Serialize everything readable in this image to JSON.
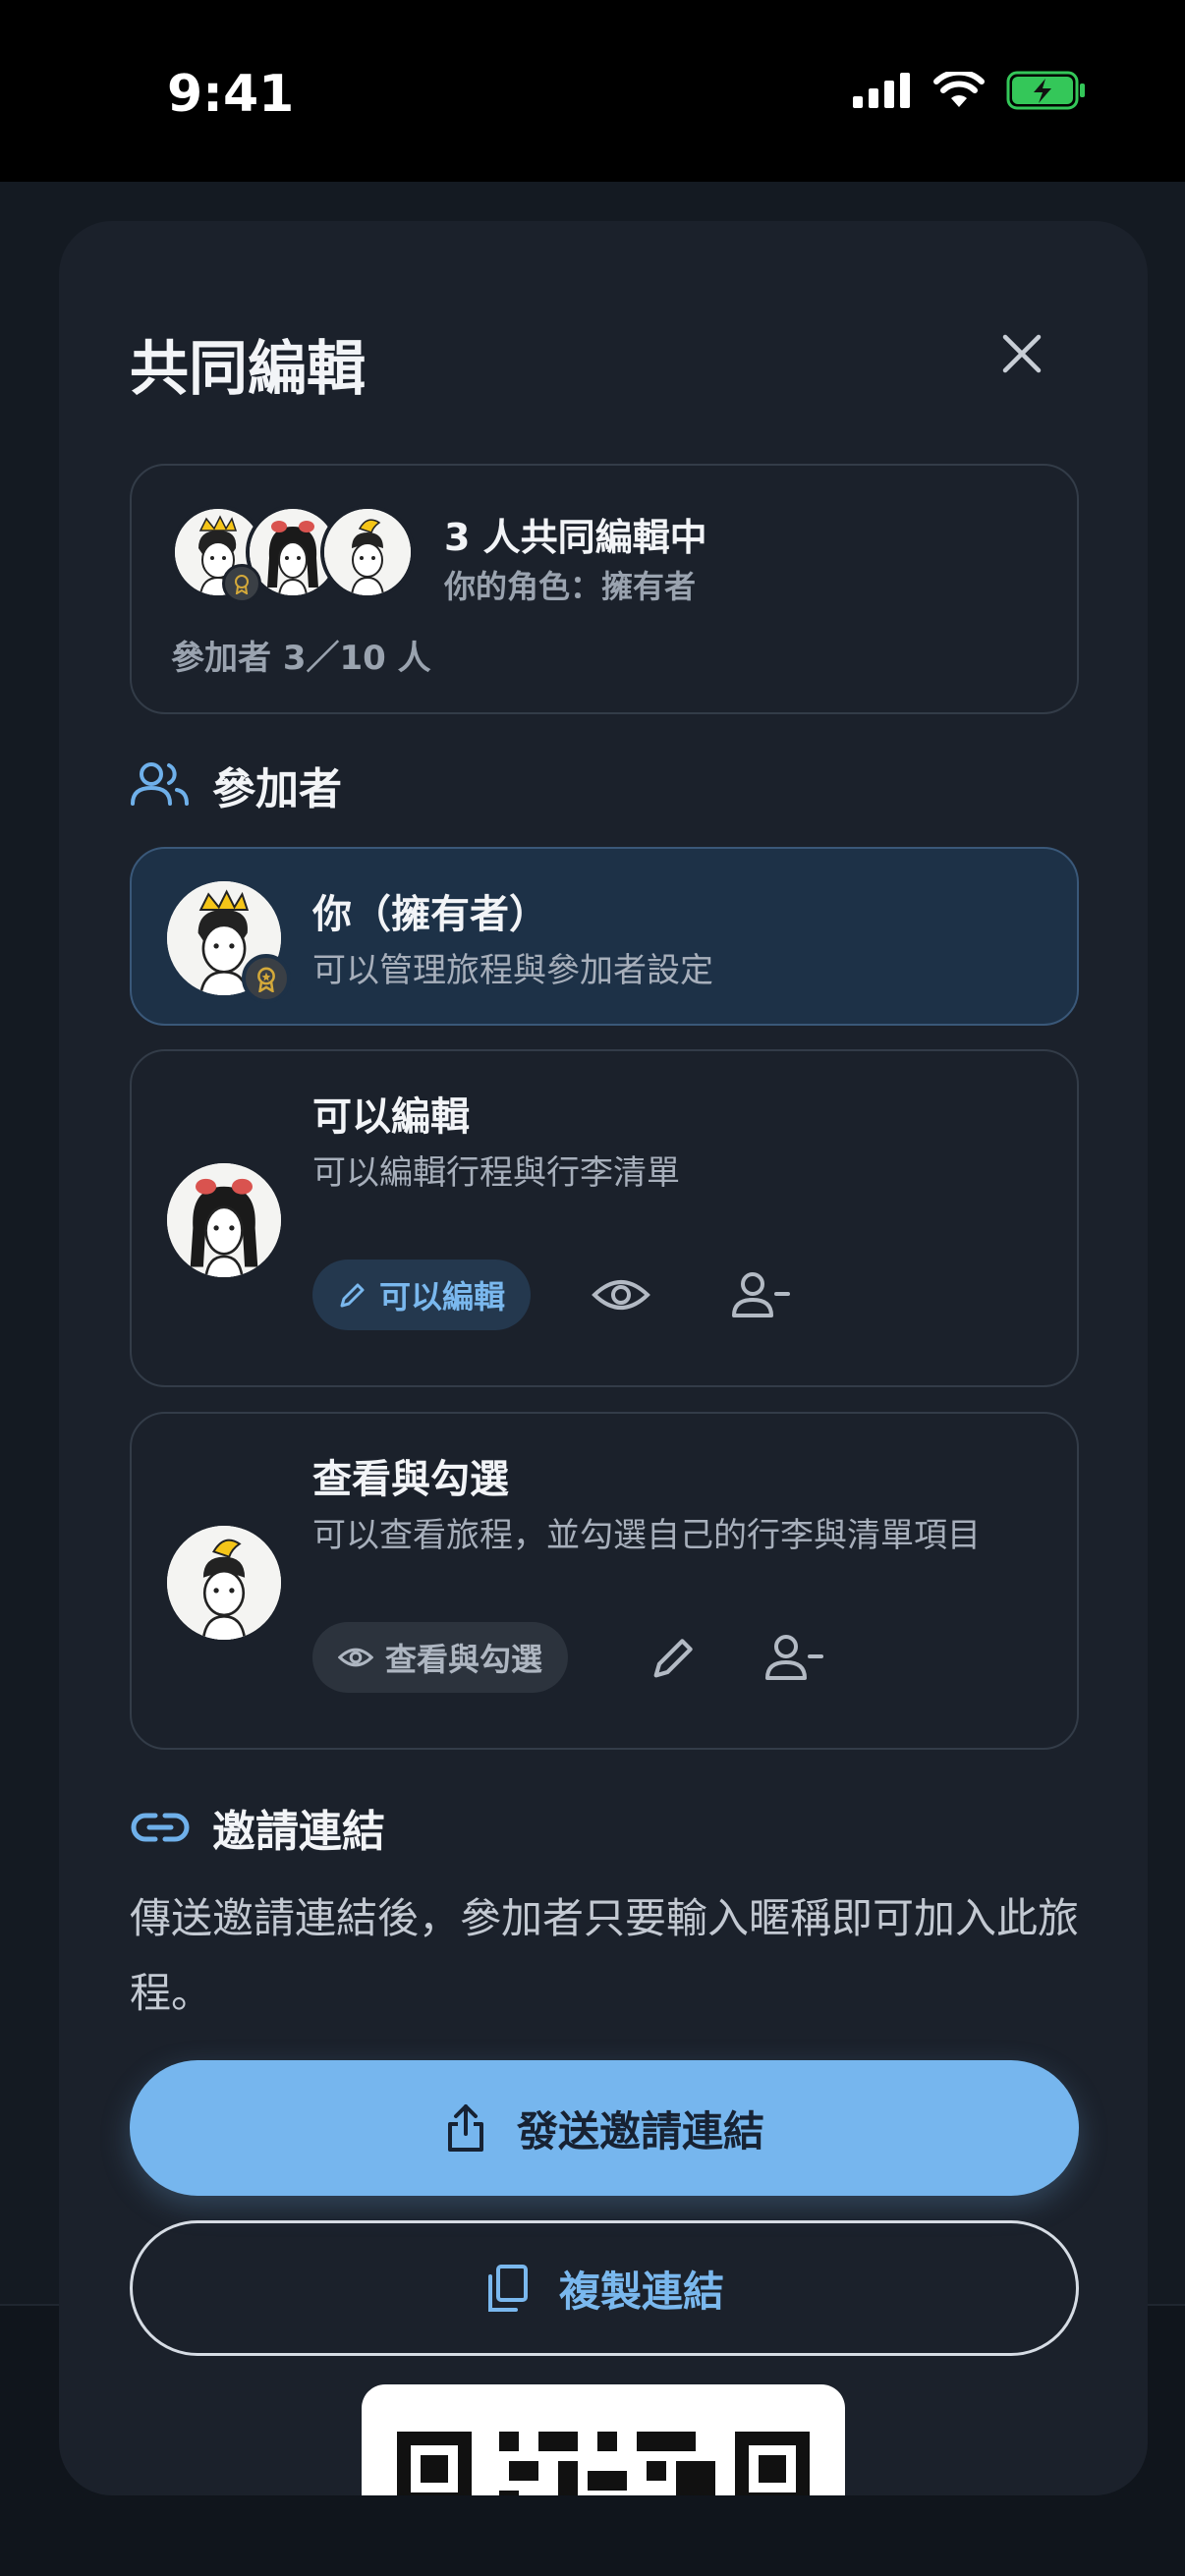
{
  "status_bar": {
    "time": "9:41"
  },
  "sheet": {
    "title": "共同編輯",
    "summary": {
      "title": "3 人共同編輯中",
      "role": "你的角色：擁有者",
      "count": "參加者 3／10 人"
    },
    "participants_section": {
      "title": "參加者",
      "items": [
        {
          "name": "你（擁有者）",
          "desc": "可以管理旅程與參加者設定"
        },
        {
          "name": "可以編輯",
          "desc": "可以編輯行程與行李清單",
          "chip_label": "可以編輯"
        },
        {
          "name": "查看與勾選",
          "desc": "可以查看旅程，並勾選自己的行李與清單項目",
          "chip_label": "查看與勾選"
        }
      ]
    },
    "invite_section": {
      "title": "邀請連結",
      "desc": "傳送邀請連結後，參加者只要輸入暱稱即可加入此旅程。",
      "send_button": "發送邀請連結",
      "copy_button": "複製連結"
    }
  },
  "colors": {
    "accent": "#76b6ee",
    "sheet_bg": "#1b212b",
    "owner_card_bg": "#1d3147",
    "battery": "#34c759"
  },
  "icons": [
    "close-icon",
    "users-icon",
    "eye-icon",
    "pencil-icon",
    "remove-user-icon",
    "link-icon",
    "share-icon",
    "copy-icon"
  ]
}
